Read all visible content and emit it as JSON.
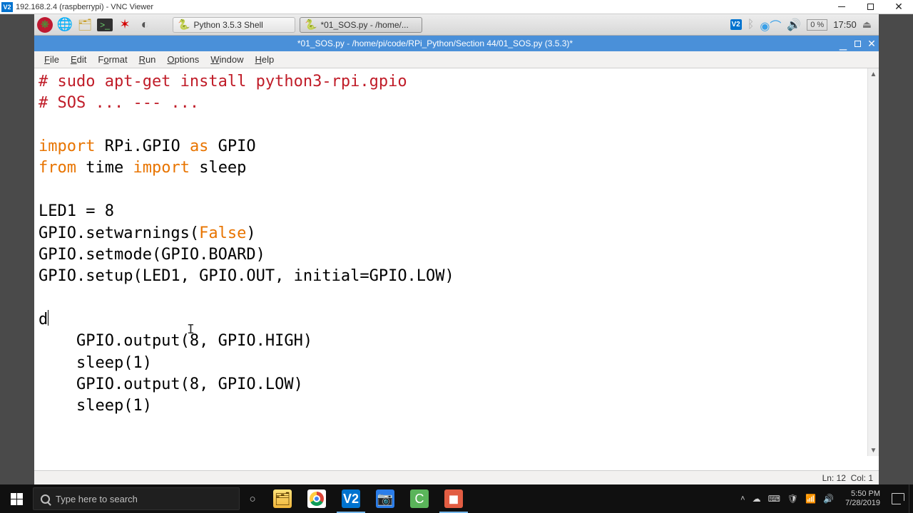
{
  "host_window": {
    "app_icon_text": "V2",
    "title": "192.168.2.4 (raspberrypi) - VNC Viewer"
  },
  "lxpanel": {
    "tasks": [
      {
        "icon": "python-icon",
        "label": "Python 3.5.3 Shell"
      },
      {
        "icon": "python-icon",
        "label": "*01_SOS.py - /home/..."
      }
    ],
    "tray": {
      "vnc_text": "V2",
      "cpu_pct": "0 %",
      "clock": "17:50"
    }
  },
  "idle": {
    "titlebar": "*01_SOS.py - /home/pi/code/RPi_Python/Section 44/01_SOS.py (3.5.3)*",
    "menu": [
      "File",
      "Edit",
      "Format",
      "Run",
      "Options",
      "Window",
      "Help"
    ],
    "status": {
      "line_label": "Ln:",
      "line": "12",
      "col_label": "Col:",
      "col": "1"
    },
    "code": {
      "l1a": "# sudo apt-get install python3-rpi.gpio",
      "l2a": "# SOS ... --- ...",
      "l4_kw1": "import",
      "l4_mid": " RPi.GPIO ",
      "l4_kw2": "as",
      "l4_end": " GPIO",
      "l5_kw1": "from",
      "l5_mid": " time ",
      "l5_kw2": "import",
      "l5_end": " sleep",
      "l7": "LED1 = 8",
      "l8a": "GPIO.setwarnings(",
      "l8_kw": "False",
      "l8b": ")",
      "l9": "GPIO.setmode(GPIO.BOARD)",
      "l10": "GPIO.setup(LED1, GPIO.OUT, initial=GPIO.LOW)",
      "l12": "d",
      "l13": "    GPIO.output(8, GPIO.HIGH)",
      "l14": "    sleep(1)",
      "l15": "    GPIO.output(8, GPIO.LOW)",
      "l16": "    sleep(1)"
    }
  },
  "win_taskbar": {
    "search_placeholder": "Type here to search",
    "systray": {
      "time": "5:50 PM",
      "date": "7/28/2019"
    }
  }
}
